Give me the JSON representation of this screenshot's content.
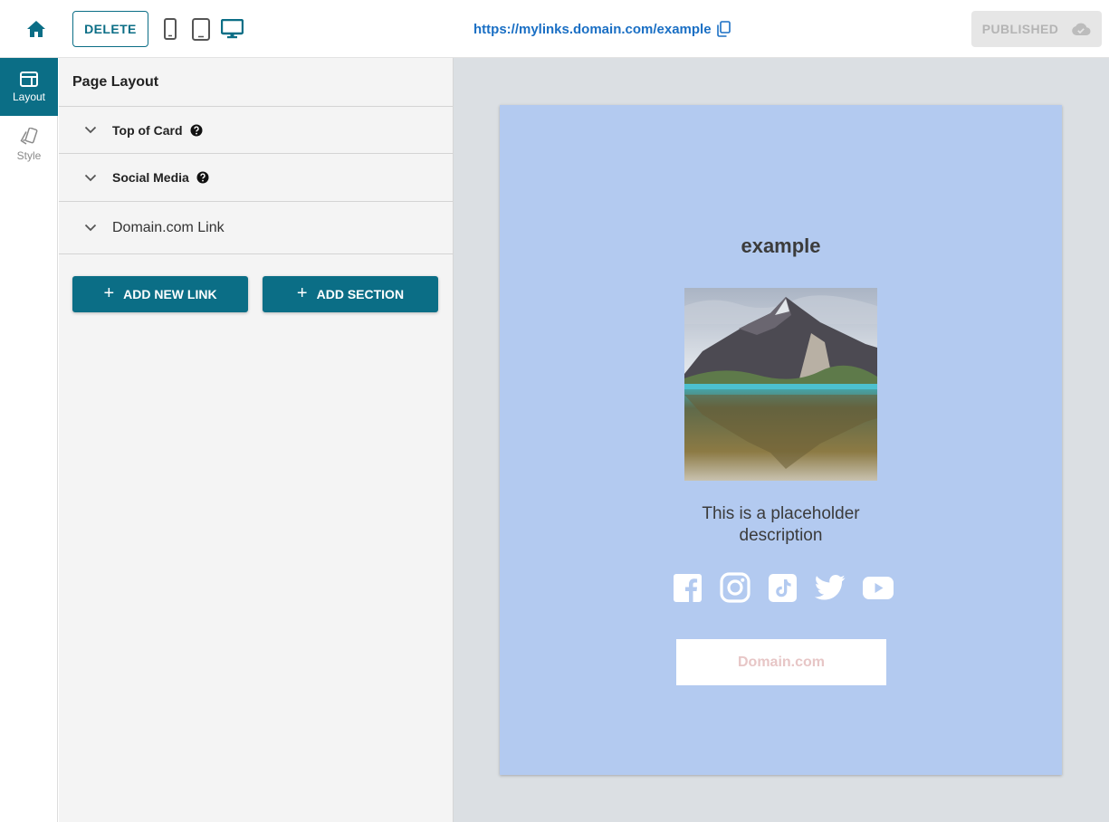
{
  "header": {
    "delete_label": "DELETE",
    "url": "https://mylinks.domain.com/example",
    "publish_label": "PUBLISHED"
  },
  "rail": {
    "items": [
      {
        "label": "Layout",
        "active": true
      },
      {
        "label": "Style",
        "active": false
      }
    ]
  },
  "panel": {
    "title": "Page Layout",
    "sections": [
      {
        "label": "Top of Card",
        "help": true
      },
      {
        "label": "Social Media",
        "help": true
      },
      {
        "label": "Domain.com Link",
        "help": false
      }
    ],
    "add_link_label": "ADD NEW LINK",
    "add_section_label": "ADD SECTION"
  },
  "card": {
    "title": "example",
    "description": "This is a placeholder description",
    "link_label": "Domain.com",
    "socials": [
      "facebook-icon",
      "instagram-icon",
      "tiktok-icon",
      "twitter-icon",
      "youtube-icon"
    ]
  },
  "colors": {
    "accent": "#0b6e86",
    "card_bg": "#b3caf0",
    "preview_bg": "#dbdfe3",
    "link_text": "#1a6fc4"
  }
}
